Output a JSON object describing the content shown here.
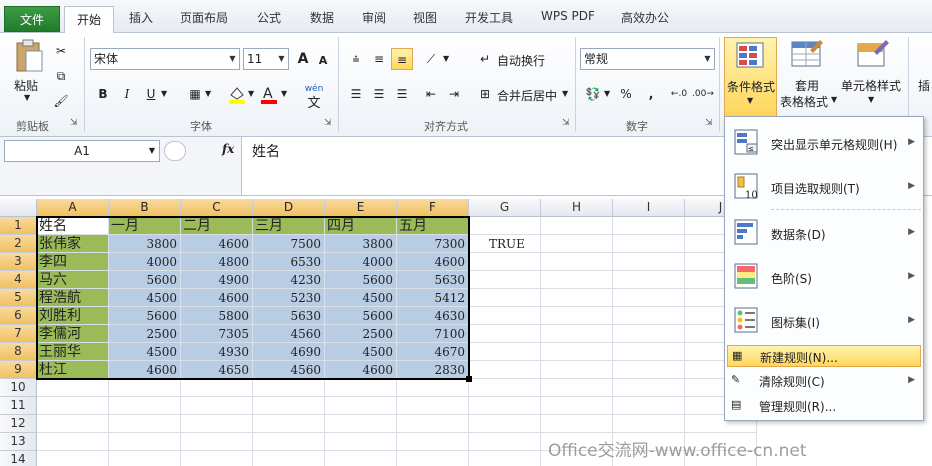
{
  "tabs": {
    "file": "文件",
    "active": "开始",
    "others": [
      "插入",
      "页面布局",
      "公式",
      "数据",
      "审阅",
      "视图",
      "开发工具",
      "WPS PDF",
      "高效办公"
    ]
  },
  "ribbon": {
    "clipboard": {
      "paste": "粘贴",
      "label": "剪贴板"
    },
    "font": {
      "name": "宋体",
      "size": "11",
      "bold": "B",
      "italic": "I",
      "underline": "U",
      "grow": "A",
      "shrink": "A",
      "label": "字体",
      "wen": "wén",
      "wen_char": "文"
    },
    "align": {
      "wrap": "自动换行",
      "merge": "合并后居中",
      "label": "对齐方式"
    },
    "number": {
      "format": "常规",
      "percent": "%",
      "comma": ",",
      "label": "数字"
    },
    "styles": {
      "cond_format": "条件格式",
      "table_fmt_1": "套用",
      "table_fmt_2": "表格格式",
      "cell_style": "单元格样式",
      "insert": "插"
    }
  },
  "formula": {
    "namebox": "A1",
    "fx": "fx",
    "content": "姓名"
  },
  "grid": {
    "columns": [
      "A",
      "B",
      "C",
      "D",
      "E",
      "F",
      "G",
      "H",
      "I",
      "J"
    ],
    "rows": [
      "1",
      "2",
      "3",
      "4",
      "5",
      "6",
      "7",
      "8",
      "9",
      "10",
      "11",
      "12",
      "13",
      "14"
    ],
    "header_row": [
      "姓名",
      "一月",
      "二月",
      "三月",
      "四月",
      "五月"
    ],
    "data": [
      {
        "name": "张伟家",
        "vals": [
          "3800",
          "4600",
          "7500",
          "3800",
          "7300"
        ]
      },
      {
        "name": "李四",
        "vals": [
          "4000",
          "4800",
          "6530",
          "4000",
          "4600"
        ]
      },
      {
        "name": "马六",
        "vals": [
          "5600",
          "4900",
          "4230",
          "5600",
          "5630"
        ]
      },
      {
        "name": "程浩航",
        "vals": [
          "4500",
          "4600",
          "5230",
          "4500",
          "5412"
        ]
      },
      {
        "name": "刘胜利",
        "vals": [
          "5600",
          "5800",
          "5630",
          "5600",
          "4630"
        ]
      },
      {
        "name": "李儒河",
        "vals": [
          "2500",
          "7305",
          "4560",
          "2500",
          "7100"
        ]
      },
      {
        "name": "王丽华",
        "vals": [
          "4500",
          "4930",
          "4690",
          "4500",
          "4670"
        ]
      },
      {
        "name": "杜江",
        "vals": [
          "4600",
          "4650",
          "4560",
          "4600",
          "2830"
        ]
      }
    ],
    "g2": "TRUE"
  },
  "menu": {
    "items": [
      {
        "label": "突出显示单元格规则(H)",
        "icon": "highlight-rules-icon"
      },
      {
        "label": "项目选取规则(T)",
        "icon": "top-bottom-rules-icon"
      },
      {
        "label": "数据条(D)",
        "icon": "data-bars-icon"
      },
      {
        "label": "色阶(S)",
        "icon": "color-scales-icon"
      },
      {
        "label": "图标集(I)",
        "icon": "icon-sets-icon"
      }
    ],
    "small_items": [
      {
        "label": "新建规则(N)..."
      },
      {
        "label": "清除规则(C)"
      },
      {
        "label": "管理规则(R)..."
      }
    ]
  },
  "watermark": "Office交流网-www.office-cn.net",
  "colors": {
    "green": "#9bbb59",
    "blue": "#b8cce4",
    "header_sel": "#f1c15f",
    "menu_highlight": "#ffe27a"
  }
}
